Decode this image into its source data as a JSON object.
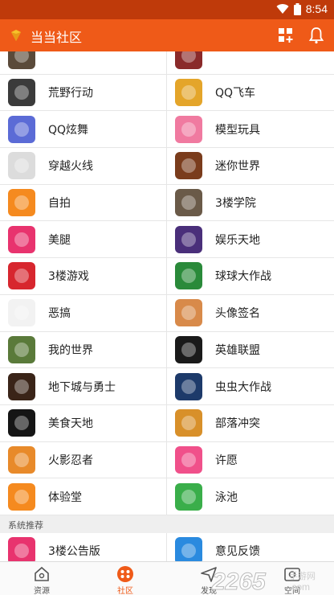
{
  "status": {
    "time": "8:54"
  },
  "header": {
    "title": "当当社区"
  },
  "rows": [
    {
      "left": {
        "label": "",
        "icon": "partial-top-left-icon",
        "color": "#5a4a3a"
      },
      "right": {
        "label": "",
        "icon": "partial-top-right-icon",
        "color": "#8a2a2a"
      }
    },
    {
      "left": {
        "label": "荒野行动",
        "icon": "wilderness-action-icon",
        "color": "#3b3b3b"
      },
      "right": {
        "label": "QQ飞车",
        "icon": "qq-speed-icon",
        "color": "#e4a52a"
      }
    },
    {
      "left": {
        "label": "QQ炫舞",
        "icon": "qq-dance-icon",
        "color": "#5b6bd6"
      },
      "right": {
        "label": "模型玩具",
        "icon": "model-toys-icon",
        "color": "#f07aa0"
      }
    },
    {
      "left": {
        "label": "穿越火线",
        "icon": "crossfire-icon",
        "color": "#dcdcdc"
      },
      "right": {
        "label": "迷你世界",
        "icon": "mini-world-icon",
        "color": "#7a3c1c"
      }
    },
    {
      "left": {
        "label": "自拍",
        "icon": "selfie-icon",
        "color": "#f58a1f"
      },
      "right": {
        "label": "3楼学院",
        "icon": "academy-icon",
        "color": "#6a5a48"
      }
    },
    {
      "left": {
        "label": "美腿",
        "icon": "legs-icon",
        "color": "#e8336e"
      },
      "right": {
        "label": "娱乐天地",
        "icon": "entertainment-icon",
        "color": "#4a2f7a"
      }
    },
    {
      "left": {
        "label": "3楼游戏",
        "icon": "handheld-game-icon",
        "color": "#d7262e"
      },
      "right": {
        "label": "球球大作战",
        "icon": "ball-battle-icon",
        "color": "#2a8a3a"
      }
    },
    {
      "left": {
        "label": "恶搞",
        "icon": "meme-face-icon",
        "color": "#f2f2f2"
      },
      "right": {
        "label": "头像签名",
        "icon": "avatar-signature-icon",
        "color": "#d88a4a"
      }
    },
    {
      "left": {
        "label": "我的世界",
        "icon": "minecraft-icon",
        "color": "#5a7a3a"
      },
      "right": {
        "label": "英雄联盟",
        "icon": "league-icon",
        "color": "#1a1a1a"
      }
    },
    {
      "left": {
        "label": "地下城与勇士",
        "icon": "dungeon-icon",
        "color": "#3a2418"
      },
      "right": {
        "label": "虫虫大作战",
        "icon": "worm-battle-icon",
        "color": "#1d3a6a"
      }
    },
    {
      "left": {
        "label": "美食天地",
        "icon": "food-icon",
        "color": "#151515"
      },
      "right": {
        "label": "部落冲突",
        "icon": "clash-icon",
        "color": "#d8902a"
      }
    },
    {
      "left": {
        "label": "火影忍者",
        "icon": "naruto-icon",
        "color": "#e88a2a"
      },
      "right": {
        "label": "许愿",
        "icon": "heart-icon",
        "color": "#f0508a"
      }
    },
    {
      "left": {
        "label": "体验堂",
        "icon": "gamepad-icon",
        "color": "#f58a1f"
      },
      "right": {
        "label": "泳池",
        "icon": "lifebuoy-icon",
        "color": "#3aae4a"
      }
    }
  ],
  "section": {
    "label": "系统推荐"
  },
  "recommend": {
    "left": {
      "label": "3楼公告版",
      "icon": "notice-board-icon",
      "color": "#e8336e"
    },
    "right": {
      "label": "意见反馈",
      "icon": "feedback-mail-icon",
      "color": "#2a8adf"
    }
  },
  "tabs": [
    {
      "label": "资源",
      "icon": "home-icon"
    },
    {
      "label": "社区",
      "icon": "community-icon",
      "active": true
    },
    {
      "label": "发现",
      "icon": "discover-icon"
    },
    {
      "label": "空间",
      "icon": "space-icon"
    }
  ],
  "watermark": {
    "text": "2265",
    "sub": "手游网",
    "url": ".com"
  },
  "accent": "#ef5a18"
}
